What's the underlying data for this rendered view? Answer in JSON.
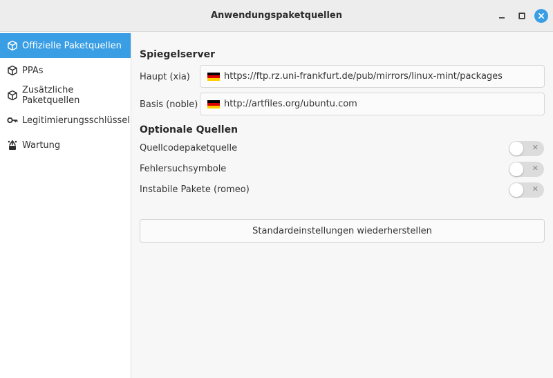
{
  "window": {
    "title": "Anwendungspaketquellen",
    "accent_color": "#3a9ee4"
  },
  "sidebar": {
    "items": [
      {
        "label": "Offizielle Paketquellen",
        "icon": "package-icon",
        "active": true
      },
      {
        "label": "PPAs",
        "icon": "package-icon",
        "active": false
      },
      {
        "label": "Zusätzliche Paketquellen",
        "icon": "package-icon",
        "active": false
      },
      {
        "label": "Legitimierungsschlüssel",
        "icon": "key-icon",
        "active": false
      },
      {
        "label": "Wartung",
        "icon": "maintenance-icon",
        "active": false
      }
    ]
  },
  "main": {
    "mirrors": {
      "title": "Spiegelserver",
      "rows": [
        {
          "label": "Haupt (xia)",
          "url": "https://ftp.rz.uni-frankfurt.de/pub/mirrors/linux-mint/packages",
          "flag": "de-flag-icon"
        },
        {
          "label": "Basis (noble)",
          "url": "http://artfiles.org/ubuntu.com",
          "flag": "de-flag-icon"
        }
      ]
    },
    "optional": {
      "title": "Optionale Quellen",
      "rows": [
        {
          "label": "Quellcodepaketquelle",
          "enabled": false
        },
        {
          "label": "Fehlersuchsymbole",
          "enabled": false
        },
        {
          "label": "Instabile Pakete (romeo)",
          "enabled": false
        }
      ]
    },
    "reset_label": "Standardeinstellungen wiederherstellen"
  }
}
